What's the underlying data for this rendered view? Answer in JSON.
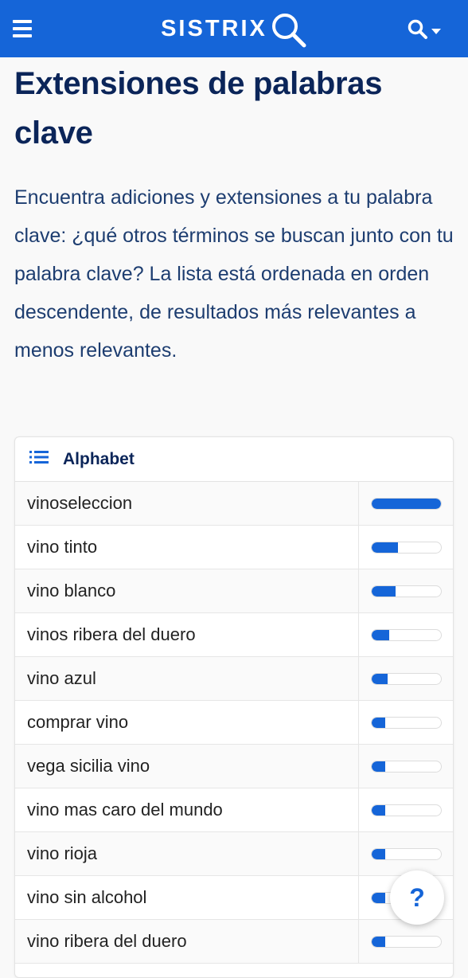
{
  "header": {
    "logo_text": "SISTRIX",
    "menu_icon": "hamburger-menu-icon",
    "search_icon": "search-icon",
    "brand_color": "#1565d8"
  },
  "main": {
    "title": "Extensiones de palabras clave",
    "intro": "Encuentra adiciones y extensiones a tu palabra clave: ¿qué otros términos se buscan junto con tu palabra clave? La lista está ordenada en orden descendente, de resultados más relevantes a menos relevantes."
  },
  "card": {
    "title": "Alphabet",
    "rows": [
      {
        "keyword": "vinoseleccion",
        "relevance": 1.0
      },
      {
        "keyword": "vino tinto",
        "relevance": 0.38
      },
      {
        "keyword": "vino blanco",
        "relevance": 0.34
      },
      {
        "keyword": "vinos ribera del duero",
        "relevance": 0.25
      },
      {
        "keyword": "vino azul",
        "relevance": 0.23
      },
      {
        "keyword": "comprar vino",
        "relevance": 0.19
      },
      {
        "keyword": "vega sicilia vino",
        "relevance": 0.19
      },
      {
        "keyword": "vino mas caro del mundo",
        "relevance": 0.19
      },
      {
        "keyword": "vino rioja",
        "relevance": 0.19
      },
      {
        "keyword": "vino sin alcohol",
        "relevance": 0.19
      },
      {
        "keyword": "vino ribera del duero",
        "relevance": 0.19
      }
    ]
  },
  "help_button": {
    "label": "?"
  }
}
